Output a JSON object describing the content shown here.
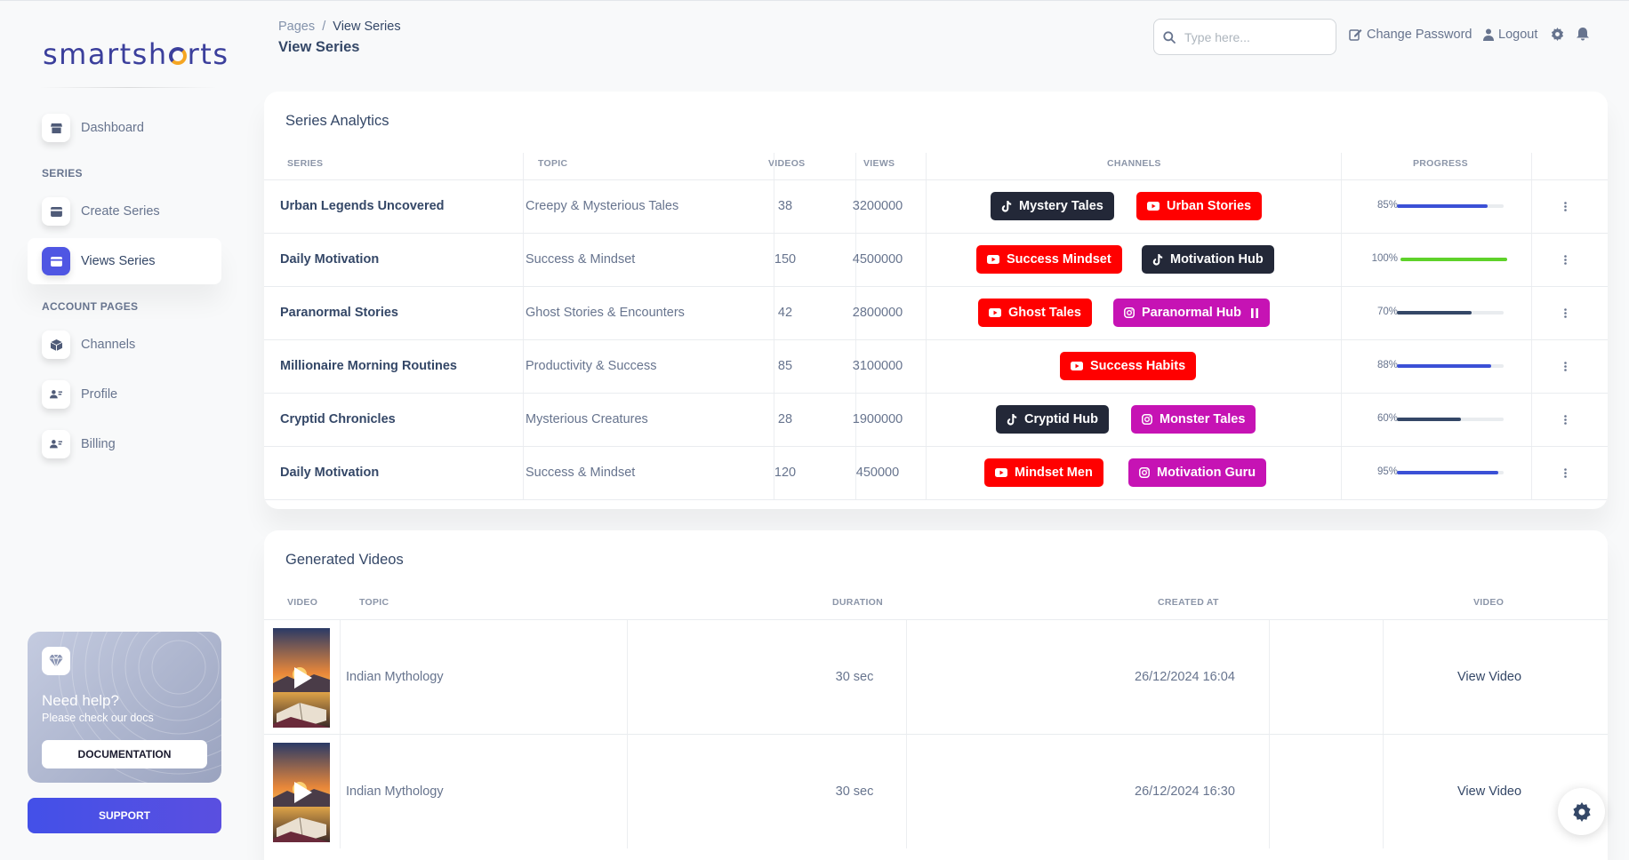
{
  "brand": {
    "logo_pre": "smartsh",
    "logo_post": "rts"
  },
  "sidebar": {
    "items": [
      {
        "label": "Dashboard",
        "icon": "shop-icon"
      },
      {
        "label": "Create Series",
        "icon": "card-icon"
      },
      {
        "label": "Views Series",
        "icon": "card-icon",
        "active": true
      },
      {
        "label": "Channels",
        "icon": "box-icon"
      },
      {
        "label": "Profile",
        "icon": "user-icon"
      },
      {
        "label": "Billing",
        "icon": "user-icon"
      }
    ],
    "section_series": "SERIES",
    "section_account": "ACCOUNT PAGES",
    "help": {
      "title": "Need help?",
      "subtitle": "Please check our docs",
      "button": "DOCUMENTATION"
    },
    "support": "SUPPORT"
  },
  "header": {
    "breadcrumb_root": "Pages",
    "breadcrumb_sep": "/",
    "breadcrumb_current": "View Series",
    "title": "View Series",
    "search_placeholder": "Type here...",
    "change_password": "Change Password",
    "logout": "Logout"
  },
  "analytics": {
    "title": "Series Analytics",
    "columns": [
      "Series",
      "Topic",
      "Videos",
      "Views",
      "Channels",
      "Progress"
    ],
    "rows": [
      {
        "series": "Urban Legends Uncovered",
        "topic": "Creepy & Mysterious Tales",
        "videos": "38",
        "views": "3200000",
        "channels": [
          {
            "name": "Mystery Tales",
            "type": "tiktok"
          },
          {
            "name": "Urban Stories",
            "type": "youtube"
          }
        ],
        "progress_label": "85%",
        "progress": 85,
        "bar": "blue"
      },
      {
        "series": "Daily Motivation",
        "topic": "Success & Mindset",
        "videos": "150",
        "views": "4500000",
        "channels": [
          {
            "name": "Success Mindset",
            "type": "youtube"
          },
          {
            "name": "Motivation Hub",
            "type": "tiktok"
          }
        ],
        "progress_label": "100%",
        "progress": 100,
        "bar": "green"
      },
      {
        "series": "Paranormal Stories",
        "topic": "Ghost Stories & Encounters",
        "videos": "42",
        "views": "2800000",
        "channels": [
          {
            "name": "Ghost Tales",
            "type": "youtube"
          },
          {
            "name": "Paranormal Hub",
            "type": "instagram",
            "extra": "pause-icon"
          }
        ],
        "progress_label": "70%",
        "progress": 70,
        "bar": "dark"
      },
      {
        "series": "Millionaire Morning Routines",
        "topic": "Productivity & Success",
        "videos": "85",
        "views": "3100000",
        "channels": [
          {
            "name": "Success Habits",
            "type": "youtube"
          }
        ],
        "progress_label": "88%",
        "progress": 88,
        "bar": "blue"
      },
      {
        "series": "Cryptid Chronicles",
        "topic": "Mysterious Creatures",
        "videos": "28",
        "views": "1900000",
        "channels": [
          {
            "name": "Cryptid Hub",
            "type": "tiktok"
          },
          {
            "name": "Monster Tales",
            "type": "instagram"
          }
        ],
        "progress_label": "60%",
        "progress": 60,
        "bar": "dark"
      },
      {
        "series": "Daily Motivation",
        "topic": "Success & Mindset",
        "videos": "120",
        "views": "450000",
        "channels": [
          {
            "name": "Mindset Men",
            "type": "youtube"
          },
          {
            "name": "Motivation Guru",
            "type": "instagram"
          }
        ],
        "progress_label": "95%",
        "progress": 95,
        "bar": "blue"
      }
    ]
  },
  "videos": {
    "title": "Generated Videos",
    "columns": [
      "Video",
      "Topic",
      "Duration",
      "Created At",
      "Video"
    ],
    "rows": [
      {
        "topic": "Indian Mythology",
        "duration": "30 sec",
        "created_at": "26/12/2024 16:04",
        "link": "View Video"
      },
      {
        "topic": "Indian Mythology",
        "duration": "30 sec",
        "created_at": "26/12/2024 16:30",
        "link": "View Video"
      }
    ]
  },
  "colors": {
    "accent": "#4f56e3",
    "youtube": "#ff0000",
    "tiktok": "#232838",
    "instagram": "#c613b4",
    "bar_blue": "#3b50d6",
    "bar_green": "#5ed22a",
    "bar_dark": "#344767"
  }
}
